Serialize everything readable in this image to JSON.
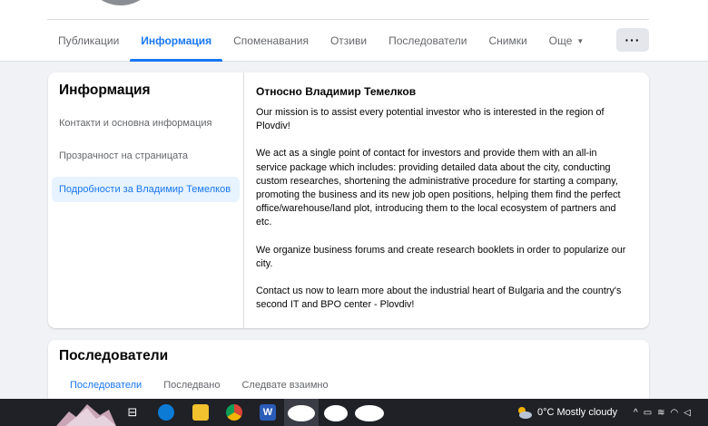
{
  "profile_nav": {
    "tabs": [
      {
        "label": "Публикации"
      },
      {
        "label": "Информация"
      },
      {
        "label": "Споменавания"
      },
      {
        "label": "Отзиви"
      },
      {
        "label": "Последователи"
      },
      {
        "label": "Снимки"
      },
      {
        "label": "Още"
      }
    ],
    "active_tab": "Информация",
    "more_button": "···"
  },
  "info": {
    "title": "Информация",
    "nav": [
      {
        "label": "Контакти и основна информация"
      },
      {
        "label": "Прозрачност на страницата"
      },
      {
        "label": "Подробности за Владимир Темелков"
      }
    ],
    "active_nav": "Подробности за Владимир Темелков",
    "about_title": "Относно Владимир Темелков",
    "paragraphs": [
      "Our mission is to assist every potential investor who is interested in the region of Plovdiv!",
      "We act as a single point of contact for investors and provide them with an all-in service package which includes: providing detailed data about the city, conducting custom researches, shortening the administrative procedure for starting a company, promoting the business and its new job open positions, helping them find the perfect office/warehouse/land plot, introducing them to the local ecosystem of partners and etc.",
      "We organize business forums and create research booklets in order to popularize our city.",
      "Contact us now to learn more about the industrial heart of Bulgaria and the country's second IT and BPO center - Plovdiv!"
    ]
  },
  "followers": {
    "title": "Последователи",
    "tabs": [
      {
        "label": "Последователи"
      },
      {
        "label": "Последвано"
      },
      {
        "label": "Следвате взаимно"
      }
    ],
    "active_tab": "Последователи"
  },
  "taskbar": {
    "weather": "0°C  Mostly cloudy",
    "accent": "#1877f2"
  }
}
